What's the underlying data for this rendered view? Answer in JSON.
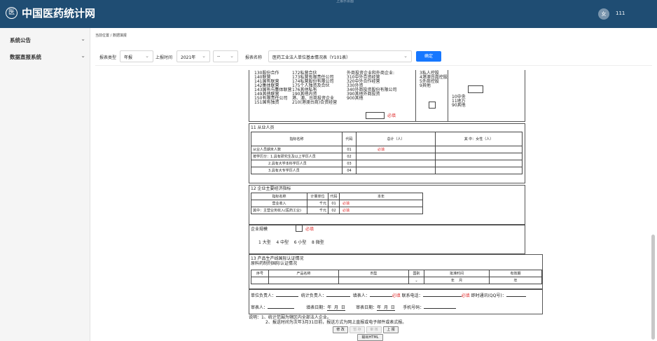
{
  "header": {
    "brand": "中国医药统计网",
    "logo": "医",
    "top_crumb": "上报示意图",
    "user_initial": "女",
    "user_name": "111"
  },
  "sidebar": {
    "items": [
      {
        "label": "系统公告"
      },
      {
        "label": "数据直报系统"
      }
    ]
  },
  "breadcrumb": "当前位置 / 数据填报",
  "filters": {
    "report_type_label": "报表类型",
    "report_type_value": "年报",
    "time_label": "上报时间",
    "year_value": "2021年",
    "period_value": "--",
    "name_label": "报表名称",
    "name_value": "医药工业法人单位基本情况表（Y101表）",
    "confirm_label": "确定"
  },
  "doc": {
    "col1": [
      "130股份合作",
      "140联营",
      "141国有联营",
      "142集体联营",
      "143国有与集体联营",
      "149其他联营",
      "150有限责任公司",
      "151国有独资"
    ],
    "col2": [
      "172私营合伙",
      "173私营有限责任公司",
      "174私营股份有限公司",
      "175个人独资及合伙",
      "176其他私有",
      "190其他内资",
      "港、澳、台商投资企业",
      "210(港澳台商)合资经营"
    ],
    "col3": [
      "外商投资企业和外商企业:",
      "310中外合资经营",
      "320中外合作经营",
      "330外资",
      "340外商投资股份有限公司",
      "390其他外商投资",
      "900其他"
    ],
    "col3_req": "必填",
    "col4": [
      "3私人控股",
      "4港澳台商控股",
      "5外商控股",
      "9其他"
    ],
    "col5": [
      "10中央",
      "11地方",
      "90其他"
    ],
    "s11": {
      "title": "11 从业人员",
      "h_name": "指标名称",
      "h_code": "代码",
      "h_total": "总计（人）",
      "h_female": "其 中：女性（人）",
      "rows": [
        {
          "name": "从业人员期末人数",
          "code": "01",
          "val": "必填"
        },
        {
          "name": "按学历分：1.具有研究生及以上学历人员",
          "code": "02",
          "val": ""
        },
        {
          "name": "2.具有大学本科学历人员",
          "code": "03",
          "val": ""
        },
        {
          "name": "3.具有大专学历人员",
          "code": "04",
          "val": ""
        }
      ]
    },
    "s12": {
      "title": "12 企业主要经济指标",
      "h_name": "指标名称",
      "h_unit": "计量单位",
      "h_code": "代码",
      "h_year": "本年",
      "rows": [
        {
          "name": "营业收入",
          "unit": "千元",
          "code": "01",
          "val": "必填"
        },
        {
          "name": "其中：主营业务收入(医药工业)",
          "unit": "千元",
          "code": "02",
          "val": "必填"
        }
      ]
    },
    "scale": {
      "label": "企业规模",
      "req": "必填",
      "options": "1 大型    4 中型    6 小型    8 微型"
    },
    "s13": {
      "title": "13 产品生产线国际认证情况",
      "subtitle": "原料药制剂国际认证情况",
      "h_no": "序号",
      "h_product": "产品名称",
      "h_form": "剂型",
      "h_country": "国别",
      "h_date": "批准时间",
      "h_valid": "有效期",
      "date_text": "年    月",
      "valid_text": "年"
    },
    "sign": {
      "l1": "单位负责人：",
      "l2": "统计负责人：",
      "l3": "填表人：",
      "req1": "必填",
      "l4": "联系电话：",
      "req2": "必填",
      "l5": "即时通讯(QQ号)：",
      "l6": "审表人：",
      "l7": "填表日期：",
      "d1": "年  月  日",
      "l8": "审表日期：",
      "d2": "年  月  日",
      "l9": "手机号码："
    },
    "notes": [
      "说明：1、统计范围为辖区内全部法人企业。",
      "2、报送时间为次年3月31日前，报送方式为网上直报或电子邮件或表式报。"
    ],
    "buttons": {
      "edit": "修 改",
      "save": "暂 存",
      "audit": "审 核",
      "submit": "上 报",
      "export": "输出HTML"
    }
  }
}
